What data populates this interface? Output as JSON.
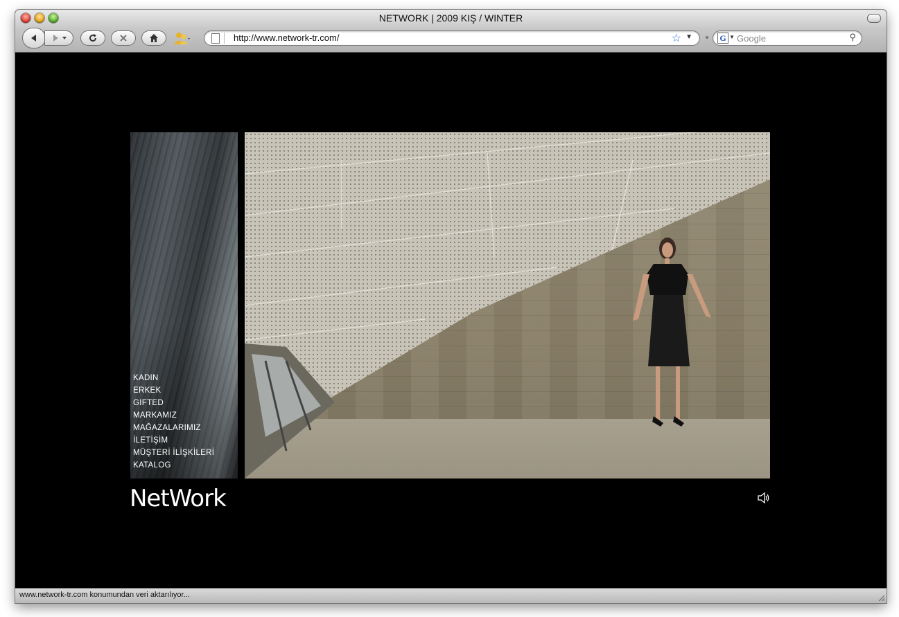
{
  "window": {
    "title": "NETWORK | 2009 KIŞ / WINTER"
  },
  "toolbar": {
    "back_icon": "back-arrow-icon",
    "forward_icon": "forward-arrow-icon",
    "reload_icon": "reload-icon",
    "stop_icon": "stop-icon",
    "home_icon": "home-icon",
    "url": "http://www.network-tr.com/",
    "search_placeholder": "Google"
  },
  "site": {
    "menu": [
      {
        "label": "KADIN"
      },
      {
        "label": "ERKEK"
      },
      {
        "label": "GIFTED"
      },
      {
        "label": "MARKAMIZ"
      },
      {
        "label": "MAĞAZALARIMIZ"
      },
      {
        "label": "İLETİŞİM"
      },
      {
        "label": "MÜŞTERİ İLİŞKİLERİ"
      },
      {
        "label": "KATALOG"
      }
    ],
    "logo": "NetWork"
  },
  "status": {
    "text": "www.network-tr.com konumundan veri aktarılıyor..."
  }
}
